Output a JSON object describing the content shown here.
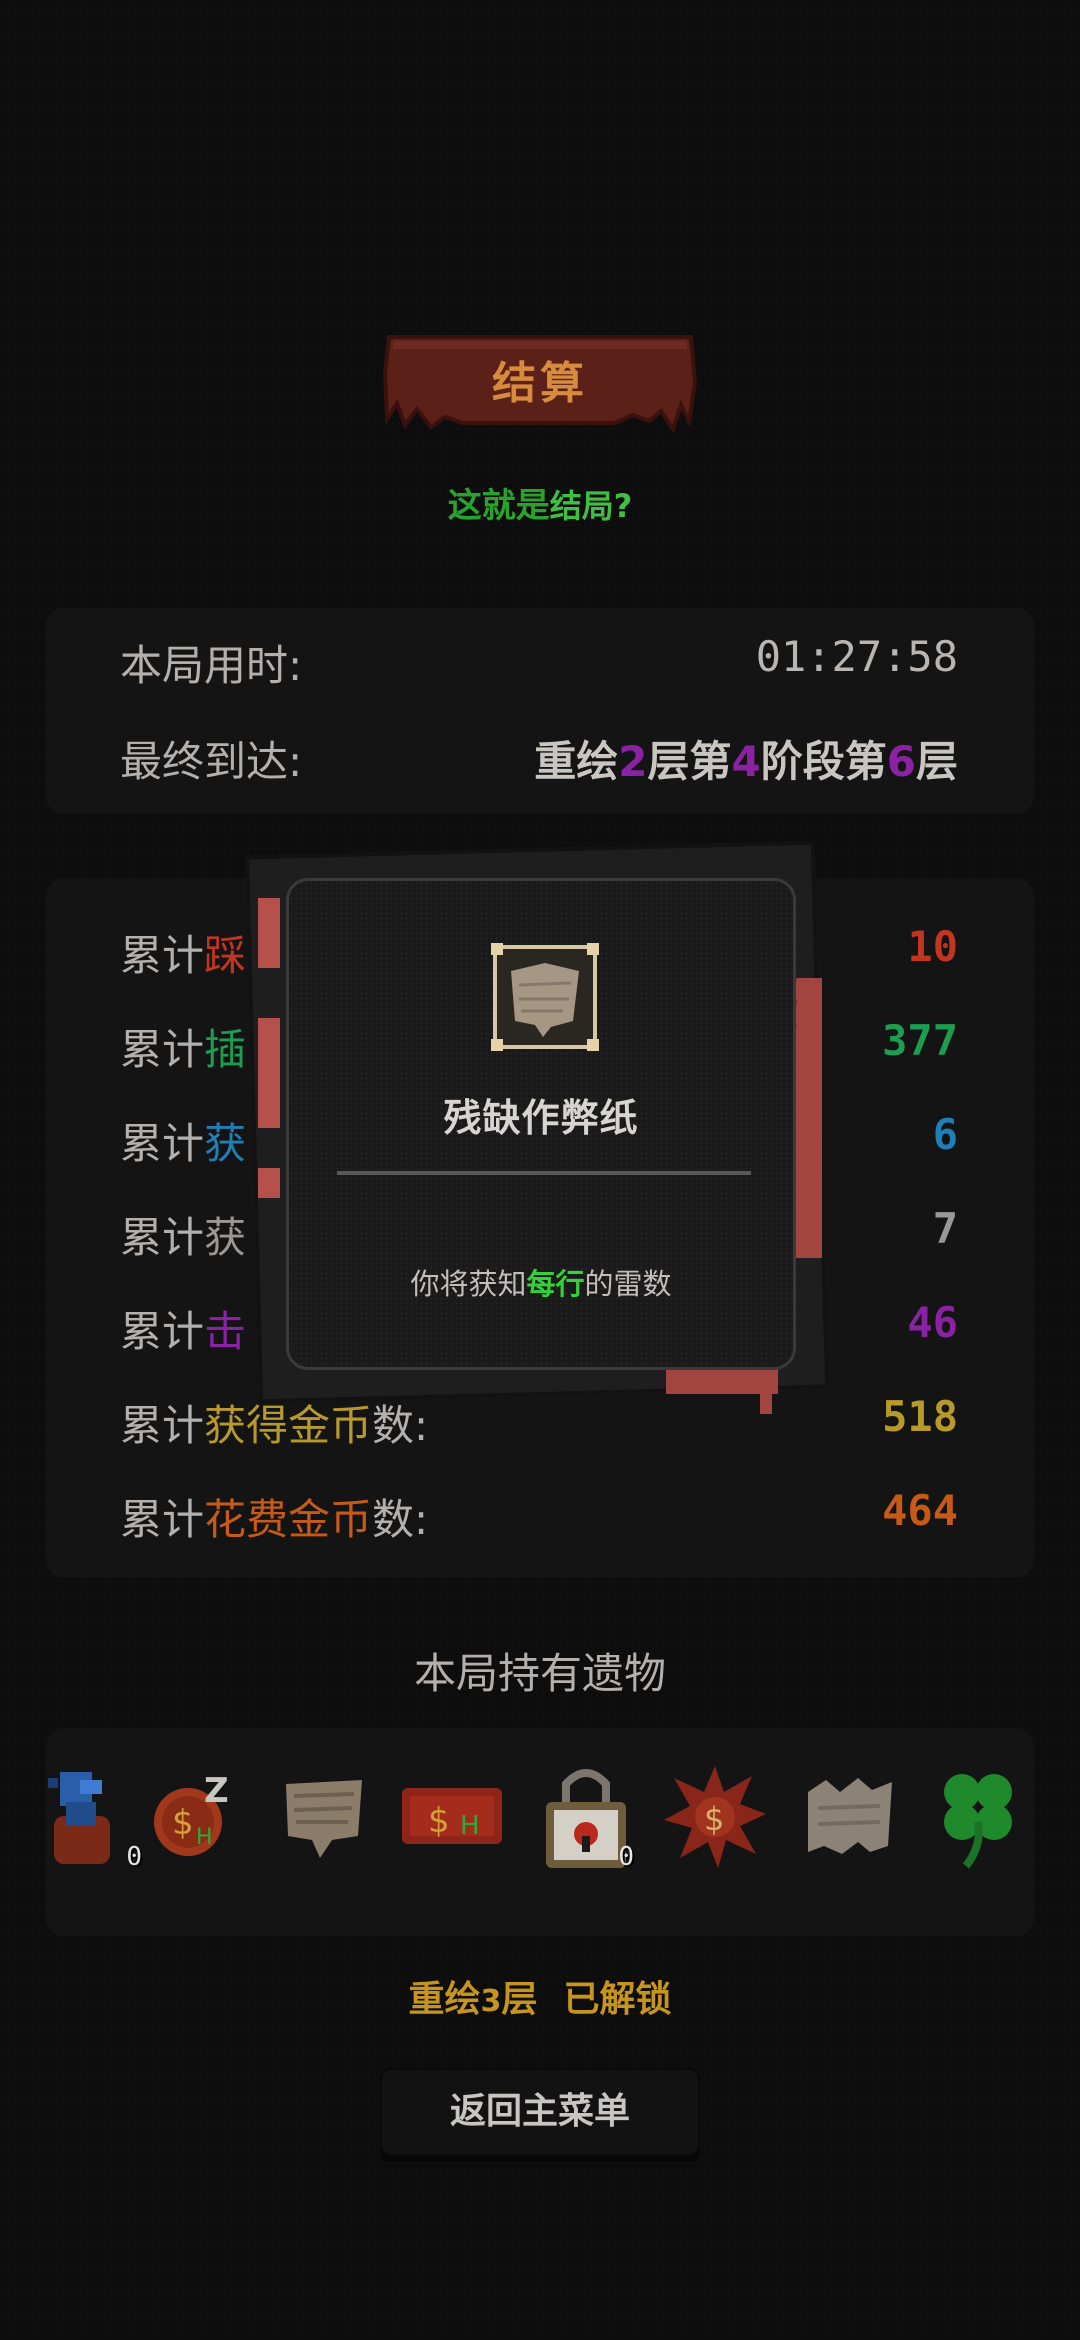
{
  "header": {
    "title": "结算",
    "subtitle_part1": "这就是",
    "subtitle_part2": "结局?"
  },
  "summary": {
    "time_label": "本局用时:",
    "time_value": "01:27:58",
    "reached_label": "最终到达:",
    "reached_parts": [
      "重绘",
      "2",
      "层第",
      "4",
      "阶段第",
      "6",
      "层"
    ]
  },
  "stats": [
    {
      "prefix": "累计",
      "highlight": "踩",
      "suffix": "",
      "value": "10",
      "color": "#c2361f"
    },
    {
      "prefix": "累计",
      "highlight": "插",
      "suffix": "",
      "value": "377",
      "color": "#1c9d4f"
    },
    {
      "prefix": "累计",
      "highlight": "获",
      "suffix": "",
      "value": "6",
      "color": "#1f7fb6"
    },
    {
      "prefix": "累计",
      "highlight": "获",
      "suffix": "",
      "value": "7",
      "color": "#9a9794"
    },
    {
      "prefix": "累计",
      "highlight": "击",
      "suffix": "",
      "value": "46",
      "color": "#8a22a4"
    },
    {
      "prefix": "累计",
      "highlight": "获得金币",
      "suffix": "数:",
      "value": "518",
      "color": "#b89a2a"
    },
    {
      "prefix": "累计",
      "highlight": "花费金币",
      "suffix": "数:",
      "value": "464",
      "color": "#c65b17"
    }
  ],
  "relics": {
    "title": "本局持有遗物",
    "items": [
      {
        "icon": "blue-bird-relic-icon",
        "count": "0"
      },
      {
        "icon": "sleep-coin-relic-icon",
        "count": ""
      },
      {
        "icon": "parchment-relic-icon",
        "count": ""
      },
      {
        "icon": "ticket-relic-icon",
        "count": ""
      },
      {
        "icon": "padlock-relic-icon",
        "count": "0"
      },
      {
        "icon": "explosion-coin-relic-icon",
        "count": ""
      },
      {
        "icon": "torn-paper-relic-icon",
        "count": ""
      },
      {
        "icon": "four-leaf-clover-relic-icon",
        "count": ""
      }
    ]
  },
  "footer": {
    "unlock_name": "重绘",
    "unlock_level": "3",
    "unlock_suffix": "层",
    "unlock_status": "已解锁",
    "menu_button": "返回主菜单"
  },
  "popup": {
    "item_name": "残缺作弊纸",
    "desc_before": "你将获知",
    "desc_highlight": "每行",
    "desc_after": "的雷数"
  },
  "colors": {
    "title": "#d68c3c",
    "banner": "#5b2018",
    "highlight_green": "#34d13a",
    "unlock_gold": "#c6951d",
    "stage_purple": "#8a22a4"
  }
}
